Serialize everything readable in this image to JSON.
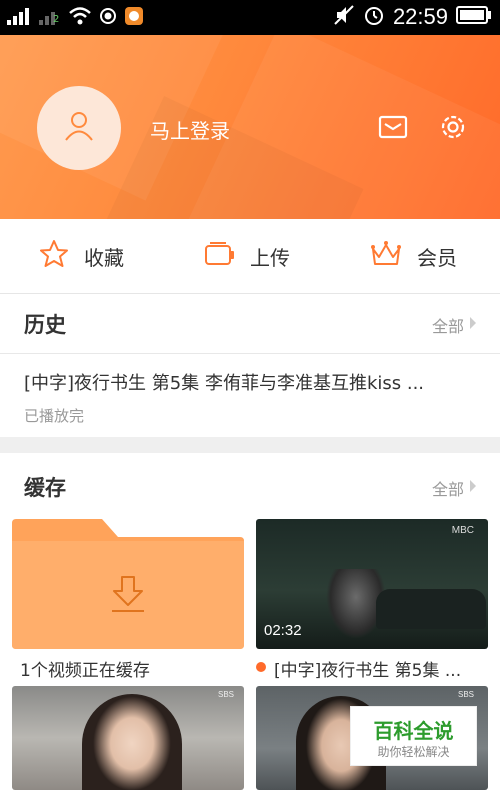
{
  "status_bar": {
    "time": "22:59",
    "carrier_tag": "2"
  },
  "header": {
    "login_label": "马上登录"
  },
  "quick_actions": [
    {
      "label": "收藏",
      "icon": "star-icon"
    },
    {
      "label": "上传",
      "icon": "upload-icon"
    },
    {
      "label": "会员",
      "icon": "crown-icon"
    }
  ],
  "history": {
    "title": "历史",
    "all_label": "全部",
    "item": {
      "title": "[中字]夜行书生 第5集 李侑菲与李准基互推kiss ...",
      "status": "已播放完"
    }
  },
  "cache": {
    "title": "缓存",
    "all_label": "全部",
    "items": [
      {
        "caption": "1个视频正在缓存"
      },
      {
        "caption": "[中字]夜行书生 第5集 ...",
        "duration": "02:32",
        "channel_logo": "MBC"
      },
      {
        "caption": "",
        "channel_logo": "SBS"
      },
      {
        "caption": "",
        "channel_logo": "SBS"
      }
    ]
  },
  "watermark": {
    "title": "百科全说",
    "subtitle": "助你轻松解决"
  },
  "colors": {
    "accent": "#ff7a33",
    "folder": "#ffa35a",
    "text": "#333333",
    "muted": "#999999"
  }
}
